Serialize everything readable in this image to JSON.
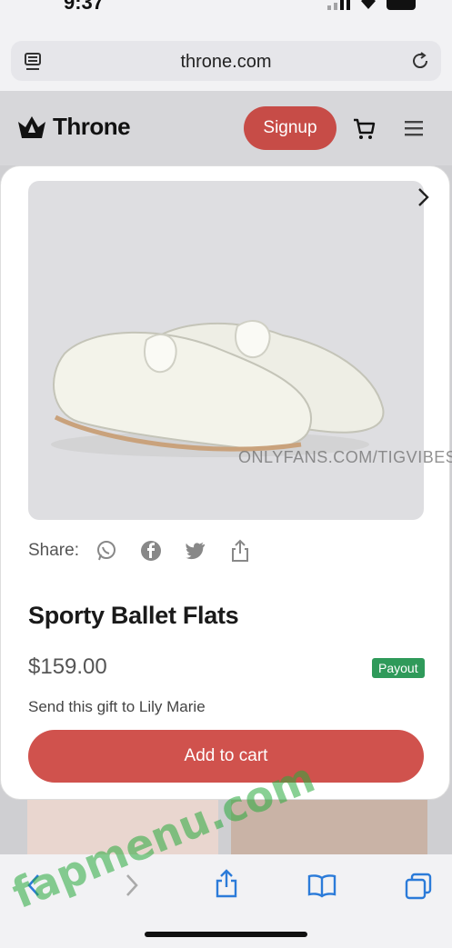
{
  "status": {
    "time": "9:37"
  },
  "browser": {
    "url": "throne.com"
  },
  "header": {
    "brand": "Throne",
    "signup_label": "Signup"
  },
  "product": {
    "image_watermark": "ONLYFANS.COM/TIGVIBES",
    "share_label": "Share:",
    "title": "Sporty Ballet Flats",
    "price": "$159.00",
    "badge": "Payout",
    "gift_text": "Send this gift to Lily Marie",
    "add_to_cart_label": "Add to cart"
  },
  "overlay": {
    "watermark": "fapmenu.com"
  },
  "colors": {
    "brand_red": "#d0524d",
    "payout_green": "#2f9a5a"
  },
  "icons": [
    "tabs-icon",
    "reload-icon",
    "crown-logo-icon",
    "cart-icon",
    "menu-icon",
    "close-icon",
    "whatsapp-icon",
    "facebook-icon",
    "twitter-icon",
    "share-icon",
    "back-icon",
    "forward-icon",
    "share-sheet-icon",
    "bookmarks-icon",
    "tabs-overview-icon"
  ]
}
